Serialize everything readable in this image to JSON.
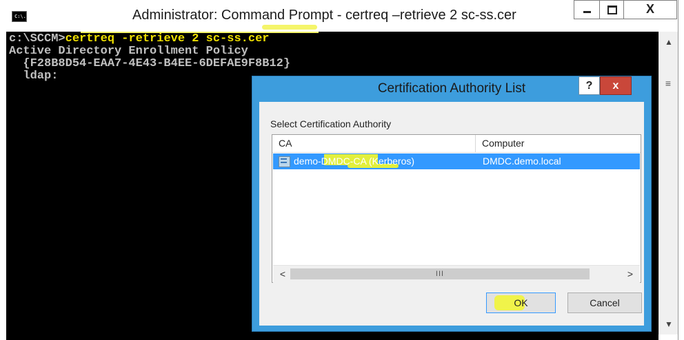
{
  "window": {
    "icon_text": "C:\\.",
    "title": "Administrator: Command Prompt - certreq  –retrieve 2 sc-ss.cer",
    "minimize_icon": "minimize-icon",
    "maximize_icon": "maximize-icon",
    "close_symbol": "X"
  },
  "console": {
    "prompt": "c:\\SCCM>",
    "command": "certreq -retrieve 2 sc-ss.cer",
    "lines": [
      "Active Directory Enrollment Policy",
      "  {F28B8D54-EAA7-4E43-B4EE-6DEFAE9F8B12}",
      "  ldap:"
    ]
  },
  "scrollbar": {
    "up": "▲",
    "down": "▼",
    "grip": "≡"
  },
  "dialog": {
    "title": "Certification Authority List",
    "help_label": "?",
    "close_label": "x",
    "prompt": "Select Certification Authority",
    "columns": [
      "CA",
      "Computer"
    ],
    "rows": [
      {
        "ca": "demo-DMDC-CA (Kerberos)",
        "computer": "DMDC.demo.local",
        "selected": true
      }
    ],
    "hscroll": {
      "left": "<",
      "right": ">",
      "thumb": "III"
    },
    "ok_label": "OK",
    "cancel_label": "Cancel"
  },
  "colors": {
    "console_bg": "#000000",
    "console_text": "#c0c0c0",
    "command_text": "#f0e000",
    "dialog_frame": "#3d9ddd",
    "selection": "#3399ff",
    "close_button": "#c9473a",
    "highlighter": "#f0f34a"
  }
}
